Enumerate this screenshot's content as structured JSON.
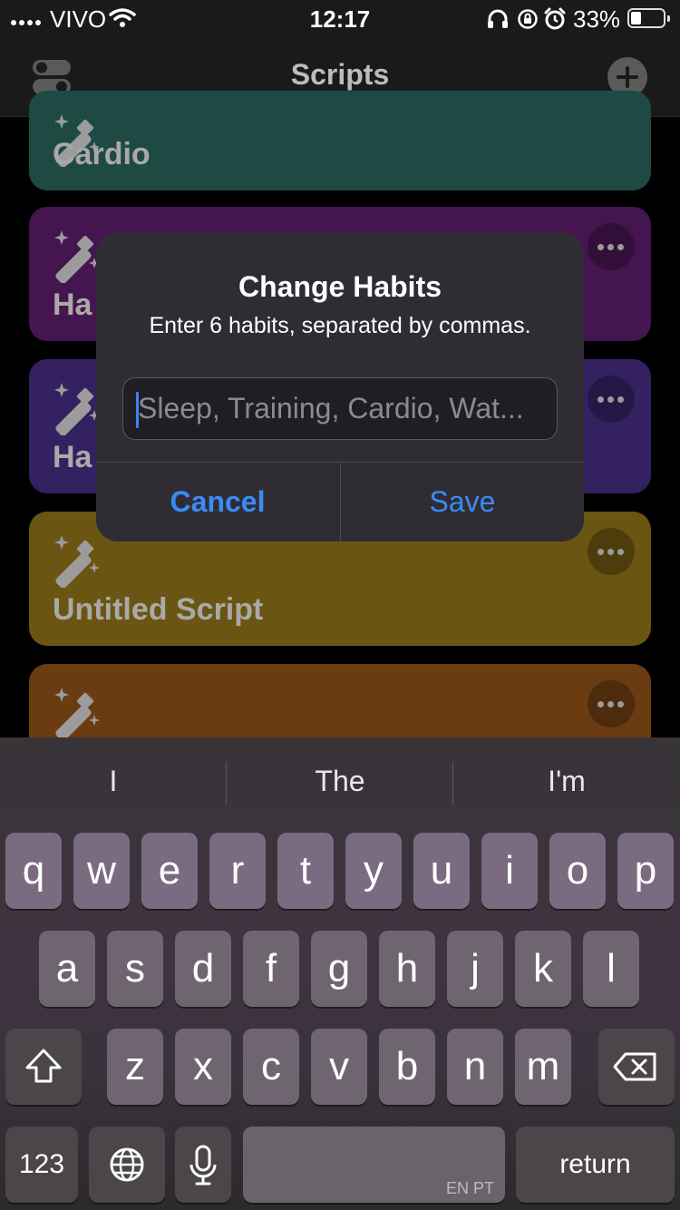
{
  "status_bar": {
    "carrier": "VIVO",
    "time": "12:17",
    "battery_percent": "33%",
    "battery_level": 0.33,
    "icons": [
      "signal-icon",
      "wifi-icon",
      "headphones-icon",
      "orientation-lock-icon",
      "alarm-icon",
      "battery-icon"
    ]
  },
  "nav": {
    "title": "Scripts",
    "left_icon": "toggles-icon",
    "right_icon": "plus-circle-icon"
  },
  "cards": [
    {
      "label": "Cardio",
      "color": "#1f4a43",
      "icon": "magic-wand-icon"
    },
    {
      "label": "Ha",
      "color": "#45154f",
      "icon": "magic-wand-icon"
    },
    {
      "label": "Ha",
      "color": "#342161",
      "icon": "magic-wand-icon"
    },
    {
      "label": "Untitled Script",
      "color": "#6b5512",
      "icon": "magic-wand-icon"
    },
    {
      "label": "",
      "color": "#6b3c12",
      "icon": "magic-wand-icon"
    }
  ],
  "dialog": {
    "title": "Change Habits",
    "message": "Enter 6 habits, separated by commas.",
    "input_value": "",
    "input_placeholder": "Sleep, Training, Cardio, Wat...",
    "cancel_label": "Cancel",
    "save_label": "Save",
    "accent_color": "#3a8bf5"
  },
  "keyboard": {
    "suggestions": [
      "I",
      "The",
      "I'm"
    ],
    "row1": [
      "q",
      "w",
      "e",
      "r",
      "t",
      "y",
      "u",
      "i",
      "o",
      "p"
    ],
    "row2": [
      "a",
      "s",
      "d",
      "f",
      "g",
      "h",
      "j",
      "k",
      "l"
    ],
    "row3": [
      "z",
      "x",
      "c",
      "v",
      "b",
      "n",
      "m"
    ],
    "shift_icon": "shift-icon",
    "backspace_icon": "backspace-icon",
    "numbers_label": "123",
    "globe_icon": "globe-icon",
    "mic_icon": "microphone-icon",
    "space_hint": "EN PT",
    "return_label": "return"
  }
}
